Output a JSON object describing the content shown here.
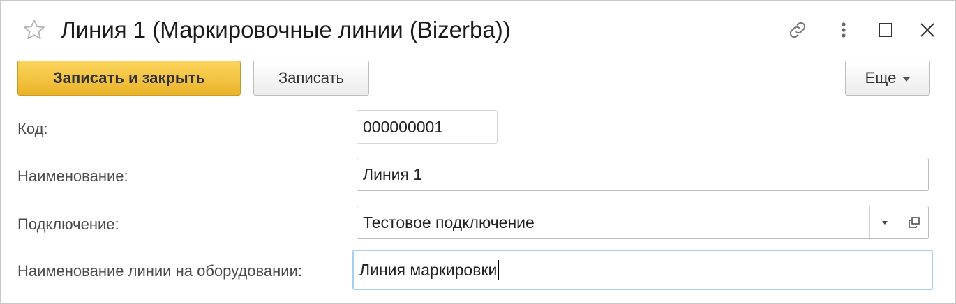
{
  "window": {
    "title": "Линия 1 (Маркировочные линии (Bizerba))",
    "icons": [
      "star-icon",
      "link-icon",
      "more-vertical-icon",
      "maximize-icon",
      "close-icon"
    ]
  },
  "toolbar": {
    "save_close_label": "Записать и закрыть",
    "save_label": "Записать",
    "more_label": "Еще",
    "primary_color": "#f0c040"
  },
  "form": {
    "code": {
      "label": "Код:",
      "value": "000000001"
    },
    "name": {
      "label": "Наименование:",
      "value": "Линия 1"
    },
    "connection": {
      "label": "Подключение:",
      "value": "Тестовое подключение"
    },
    "equipment_line": {
      "label": "Наименование линии на оборудовании:",
      "value": "Линия маркировки"
    }
  }
}
